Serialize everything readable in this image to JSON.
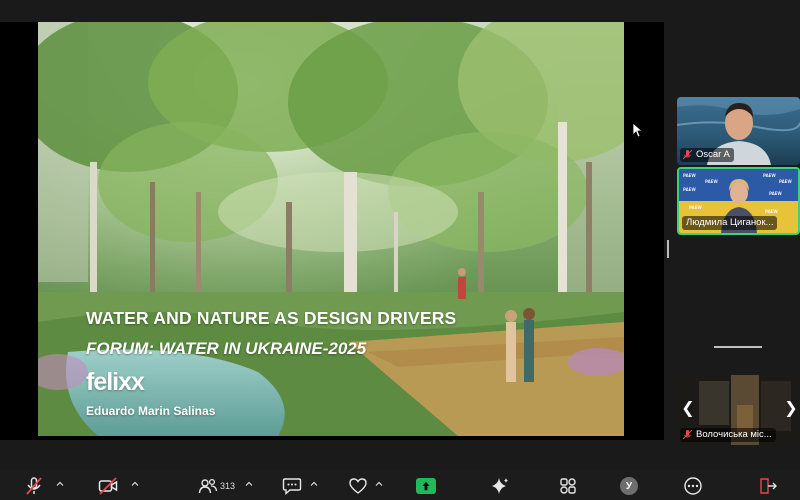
{
  "slide": {
    "title": "WATER AND NATURE AS DESIGN DRIVERS",
    "subtitle": "FORUM: WATER IN UKRAINE-2025",
    "logo": "felixx",
    "author": "Eduardo Marin Salinas"
  },
  "participants": [
    {
      "name": "Oscar A"
    },
    {
      "name": "Людмила Циганок..."
    },
    {
      "name": "Волочиська міс..."
    }
  ],
  "toolbar": {
    "participants_count": "313",
    "avatar_initial": "У"
  },
  "colors": {
    "background": "#1a1a1a",
    "active_speaker_border": "#3ad27a",
    "share_button": "#1fb85a",
    "muted_red": "#e5484d"
  }
}
